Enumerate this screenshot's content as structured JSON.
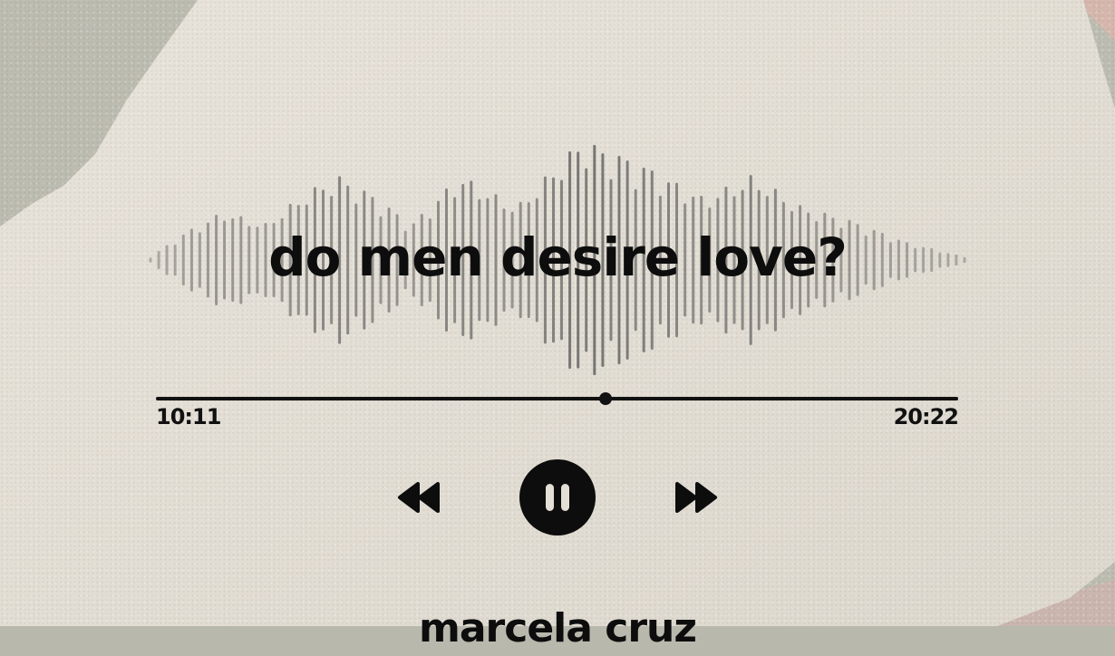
{
  "episode": {
    "title": "do men desire love?",
    "artist": "marcela cruz"
  },
  "player": {
    "elapsed": "10:11",
    "total": "20:22",
    "progress": 0.56,
    "state": "playing"
  },
  "controls": {
    "rewind_icon": "rewind-icon",
    "pause_icon": "pause-icon",
    "forward_icon": "fast-forward-icon"
  },
  "colors": {
    "ink": "#0d0d0d",
    "paper": "#e4dfd6",
    "backdrop": "#b9b8ad",
    "accent_blush": "#d6b7ae"
  }
}
